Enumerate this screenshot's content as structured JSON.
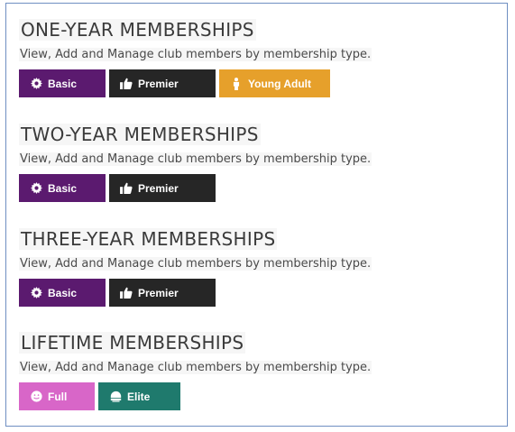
{
  "colors": {
    "basic": "#5b1a6f",
    "premier": "#262626",
    "young_adult": "#e6a02b",
    "full": "#d866c8",
    "elite": "#1f7a6d"
  },
  "description": "View, Add and Manage club members by membership type.",
  "sections": [
    {
      "title": "ONE-YEAR MEMBERSHIPS",
      "buttons": [
        {
          "label": "Basic",
          "icon": "gear-icon"
        },
        {
          "label": "Premier",
          "icon": "thumbs-up-icon"
        },
        {
          "label": "Young Adult",
          "icon": "person-icon"
        }
      ]
    },
    {
      "title": "TWO-YEAR MEMBERSHIPS",
      "buttons": [
        {
          "label": "Basic",
          "icon": "gear-icon"
        },
        {
          "label": "Premier",
          "icon": "thumbs-up-icon"
        }
      ]
    },
    {
      "title": "THREE-YEAR MEMBERSHIPS",
      "buttons": [
        {
          "label": "Basic",
          "icon": "gear-icon"
        },
        {
          "label": "Premier",
          "icon": "thumbs-up-icon"
        }
      ]
    },
    {
      "title": "LIFETIME MEMBERSHIPS",
      "buttons": [
        {
          "label": "Full",
          "icon": "smiley-icon"
        },
        {
          "label": "Elite",
          "icon": "helmet-icon"
        }
      ]
    }
  ]
}
